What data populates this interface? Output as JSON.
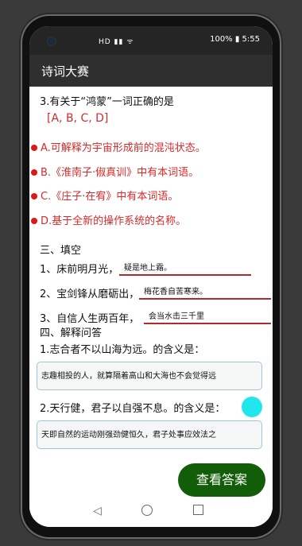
{
  "status": {
    "signal_text": "HD ▮▮ ᯤ",
    "battery": "100% ▮ 5:55"
  },
  "app": {
    "title": "诗词大赛"
  },
  "q3": {
    "title": "3.有关于“鸿蒙”一词正确的是",
    "answer": "[A, B, C, D]",
    "options": [
      "A.可解释为宇宙形成前的混沌状态。",
      "B.《淮南子·俶真训》中有本词语。",
      "C.《庄子·在宥》中有本词语。",
      "D.基于全新的操作系统的名称。"
    ]
  },
  "fill": {
    "section": "三、填空",
    "items": [
      {
        "prompt": "1、床前明月光，",
        "answer": "疑是地上霜。"
      },
      {
        "prompt": "2、宝剑锋从磨砺出，",
        "answer": "梅花香自苦寒来。"
      },
      {
        "prompt": "3、自信人生两百年，",
        "answer": "会当水击三千里"
      }
    ]
  },
  "explain": {
    "section": "四、解释问答",
    "q1": "1.志合者不以山海为远。的含义是：",
    "a1": "志趣相投的人，就算隔着高山和大海也不会觉得远",
    "q2": "2.天行健，君子以自强不息。的含义是：",
    "a2": "天即自然的运动刚强劲健恒久，君子处事应效法之"
  },
  "button": {
    "label": "查看答案"
  },
  "colors": {
    "accent_red": "#d62a2a",
    "button_green": "#125e08"
  }
}
